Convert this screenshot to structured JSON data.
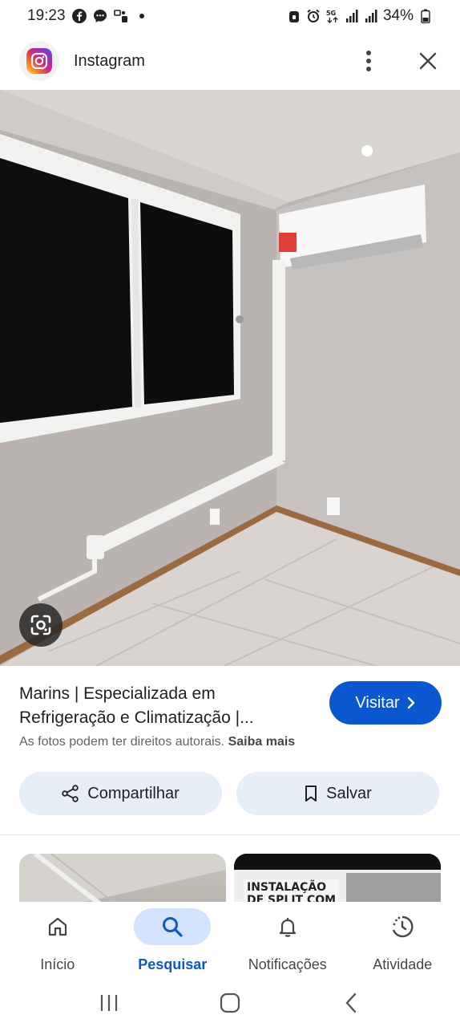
{
  "status_bar": {
    "time": "19:23",
    "battery": "34%",
    "left_icons": [
      "facebook-icon",
      "messenger-icon",
      "notification-icon",
      "dot-icon"
    ],
    "right_icons": [
      "lock-icon",
      "alarm-icon",
      "5g-icon",
      "signal-icon",
      "signal-icon",
      "battery-icon"
    ]
  },
  "header": {
    "title": "Instagram",
    "more_icon": "more-vert-icon",
    "close_icon": "close-icon"
  },
  "image": {
    "lens_icon": "google-lens-icon"
  },
  "info": {
    "title_line1": "Marins | Especializada em",
    "title_line2": "Refrigeração e Climatização |...",
    "visit_label": "Visitar",
    "copyright_text": "As fotos podem ter direitos autorais.",
    "learn_more": "Saiba mais"
  },
  "actions": {
    "share_label": "Compartilhar",
    "save_label": "Salvar"
  },
  "related": {
    "thumb2_text_line1": "INSTALAÇÃO",
    "thumb2_text_line2": "DE SPLIT COM"
  },
  "bottom_nav": {
    "items": [
      {
        "label": "Início",
        "icon": "home-icon"
      },
      {
        "label": "Pesquisar",
        "icon": "search-icon"
      },
      {
        "label": "Notificações",
        "icon": "bell-icon"
      },
      {
        "label": "Atividade",
        "icon": "activity-icon"
      }
    ],
    "active_index": 1
  },
  "colors": {
    "accent": "#0b57d0",
    "button_bg": "#e8eef8",
    "active_nav_bg": "#d3e3fd"
  }
}
